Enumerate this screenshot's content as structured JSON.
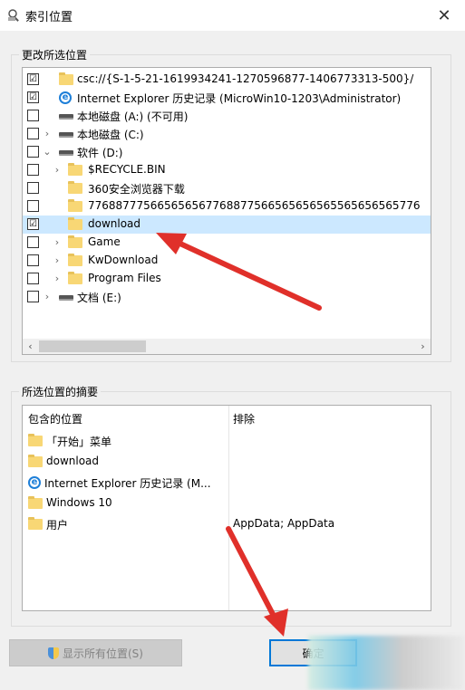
{
  "window": {
    "title": "索引位置",
    "close": "✕"
  },
  "group1": {
    "label": "更改所选位置",
    "rows": [
      {
        "text": "csc://{S-1-5-21-1619934241-1270596877-1406773313-500}/",
        "checked": "☑",
        "icon": "folder-icon"
      },
      {
        "text": "Internet Explorer 历史记录 (MicroWin10-1203\\Administrator)",
        "checked": "☑",
        "icon": "ie-icon"
      },
      {
        "text": "本地磁盘 (A:) (不可用)",
        "checked": "",
        "icon": "drive-icon"
      },
      {
        "text": "本地磁盘 (C:)",
        "checked": "",
        "icon": "drive-icon"
      },
      {
        "text": "软件 (D:)",
        "checked": "",
        "icon": "drive-icon"
      },
      {
        "text": "$RECYCLE.BIN",
        "checked": "",
        "icon": "folder-icon"
      },
      {
        "text": "360安全浏览器下载",
        "checked": "",
        "icon": "folder-icon"
      },
      {
        "text": "776887775665656567768877566565656565565656565776",
        "checked": "",
        "icon": "folder-icon"
      },
      {
        "text": "download",
        "checked": "☑",
        "icon": "folder-icon"
      },
      {
        "text": "Game",
        "checked": "",
        "icon": "folder-icon"
      },
      {
        "text": "KwDownload",
        "checked": "",
        "icon": "folder-icon"
      },
      {
        "text": "Program Files",
        "checked": "",
        "icon": "folder-icon"
      },
      {
        "text": "文档 (E:)",
        "checked": "",
        "icon": "drive-icon"
      }
    ],
    "expander_collapsed": "›",
    "expander_expanded": "⌄",
    "scroll_left": "‹",
    "scroll_right": "›"
  },
  "group2": {
    "label": "所选位置的摘要",
    "col_included": "包含的位置",
    "col_excluded": "排除",
    "rows": [
      {
        "text": "「开始」菜单",
        "icon": "folder-icon"
      },
      {
        "text": "download",
        "icon": "folder-icon"
      },
      {
        "text": "Internet Explorer 历史记录 (M...",
        "icon": "ie-icon"
      },
      {
        "text": "Windows 10",
        "icon": "folder-icon"
      },
      {
        "text": "用户",
        "icon": "folder-icon"
      }
    ],
    "excluded_value": "AppData; AppData"
  },
  "buttons": {
    "show_all": "显示所有位置(S)",
    "ok": "确定"
  },
  "colors": {
    "selected_row": "#cce8ff",
    "arrow": "#e0302a",
    "ok_border": "#0078d7"
  }
}
